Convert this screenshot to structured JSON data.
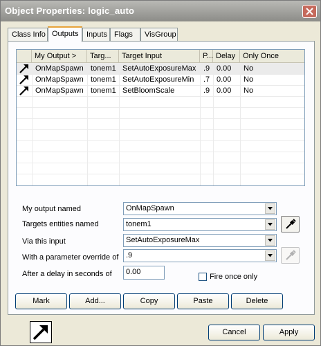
{
  "window": {
    "title": "Object Properties: logic_auto"
  },
  "tabs": [
    {
      "label": "Class Info"
    },
    {
      "label": "Outputs"
    },
    {
      "label": "Inputs"
    },
    {
      "label": "Flags"
    },
    {
      "label": "VisGroup"
    }
  ],
  "active_tab": "Outputs",
  "grid": {
    "columns": [
      "My Output >",
      "Targ...",
      "Target Input",
      "P...",
      "Delay",
      "Only Once"
    ],
    "rows": [
      {
        "output": "OnMapSpawn",
        "target": "tonem1",
        "input": "SetAutoExposureMax",
        "param": ".9",
        "delay": "0.00",
        "once": "No",
        "selected": true
      },
      {
        "output": "OnMapSpawn",
        "target": "tonem1",
        "input": "SetAutoExposureMin",
        "param": ".7",
        "delay": "0.00",
        "once": "No",
        "selected": false
      },
      {
        "output": "OnMapSpawn",
        "target": "tonem1",
        "input": "SetBloomScale",
        "param": ".9",
        "delay": "0.00",
        "once": "No",
        "selected": false
      }
    ]
  },
  "form": {
    "output_label": "My output named",
    "output_value": "OnMapSpawn",
    "targets_label": "Targets entities named",
    "targets_value": "tonem1",
    "input_label": "Via this input",
    "input_value": "SetAutoExposureMax",
    "param_label": "With a parameter override of",
    "param_value": ".9",
    "delay_label": "After a delay in seconds of",
    "delay_value": "0.00",
    "fire_once_label": "Fire once only",
    "fire_once_checked": false
  },
  "actions": {
    "mark": "Mark",
    "add": "Add...",
    "copy": "Copy",
    "paste": "Paste",
    "delete": "Delete"
  },
  "dialog": {
    "cancel": "Cancel",
    "apply": "Apply"
  },
  "icons": {
    "close": "close-icon",
    "dropdown": "chevron-down-icon",
    "eyedropper": "eyedropper-icon",
    "output": "output-arrow-icon"
  },
  "colors": {
    "title_bar": "#a3a39f",
    "active_tab_accent": "#e7a33a",
    "selected_row": "#ebebeb",
    "close_button": "#c56a5c"
  }
}
